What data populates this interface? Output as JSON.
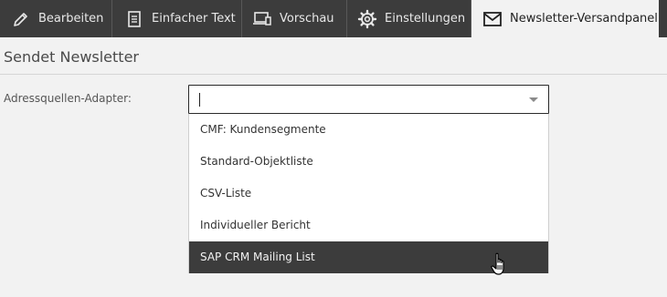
{
  "tabs": [
    {
      "label": "Bearbeiten",
      "icon": "pencil-icon"
    },
    {
      "label": "Einfacher Text",
      "icon": "document-icon"
    },
    {
      "label": "Vorschau",
      "icon": "devices-icon"
    },
    {
      "label": "Einstellungen",
      "icon": "gear-icon"
    },
    {
      "label": "Newsletter-Versandpanel",
      "icon": "envelope-icon",
      "active": true
    }
  ],
  "section": {
    "title": "Sendet Newsletter"
  },
  "form": {
    "address_source_label": "Adressquellen-Adapter:",
    "address_source_value": "",
    "options": [
      "CMF: Kundensegmente",
      "Standard-Objektliste",
      "CSV-Liste",
      "Individueller Bericht",
      "SAP CRM Mailing List"
    ],
    "highlighted_option": "SAP CRM Mailing List"
  },
  "colors": {
    "tabbar_bg": "#3c3c3c",
    "page_bg": "#f2f2f2",
    "highlight_bg": "#3c3c3c"
  }
}
